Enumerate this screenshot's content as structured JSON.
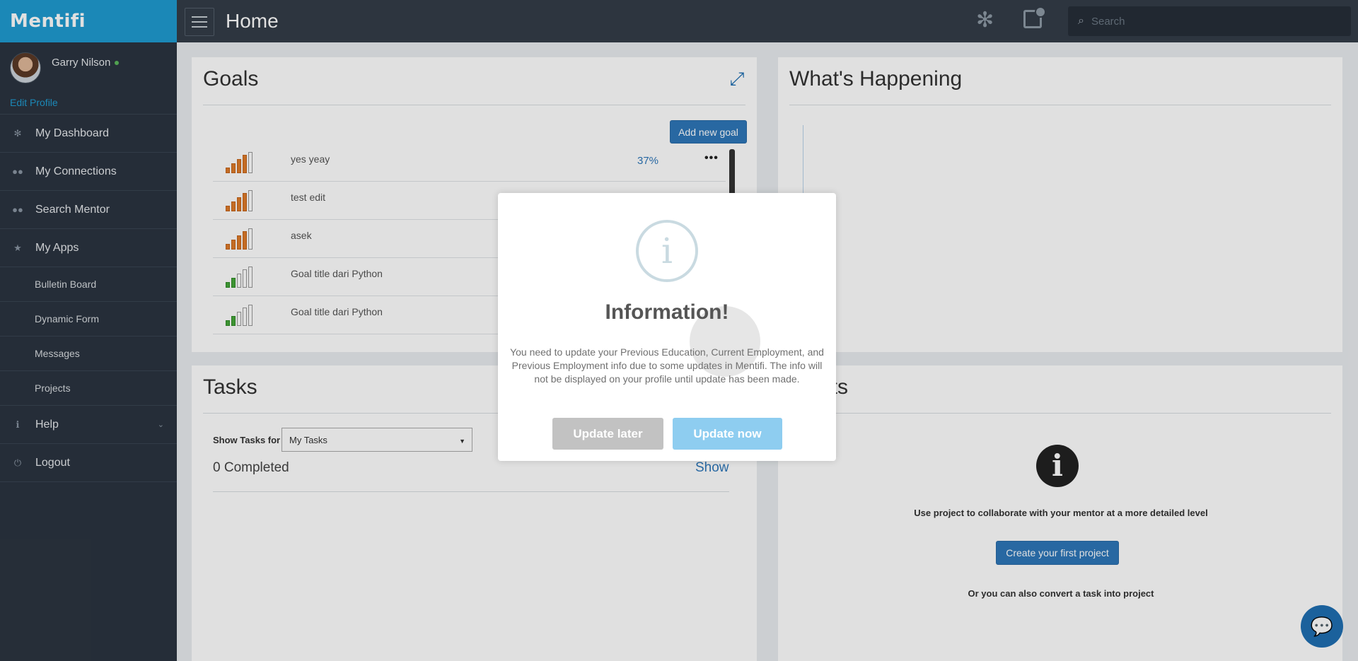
{
  "sidebar": {
    "brand": "Mentifi",
    "profile": {
      "name": "Garry Nilson",
      "edit_label": "Edit Profile"
    },
    "items": [
      {
        "label": "My Dashboard",
        "icon": "dashboard-icon"
      },
      {
        "label": "My Connections",
        "icon": "users-icon"
      },
      {
        "label": "Search Mentor",
        "icon": "users-icon"
      },
      {
        "label": "My Apps",
        "icon": "star-icon"
      }
    ],
    "apps": [
      {
        "label": "Bulletin Board"
      },
      {
        "label": "Dynamic Form"
      },
      {
        "label": "Messages"
      },
      {
        "label": "Projects"
      }
    ],
    "help": {
      "label": "Help"
    },
    "logout": {
      "label": "Logout"
    }
  },
  "header": {
    "title": "Home",
    "search_placeholder": "Search"
  },
  "goals": {
    "title": "Goals",
    "add_label": "Add new goal",
    "items": [
      {
        "title": "yes yeay",
        "percent": "37%",
        "menu": "•••",
        "level": 4,
        "color": "#e07b2a"
      },
      {
        "title": "test edit",
        "level": 4,
        "color": "#e07b2a"
      },
      {
        "title": "asek",
        "level": 4,
        "color": "#e07b2a"
      },
      {
        "title": "Goal title dari Python",
        "level": 1,
        "color": "#46a83a"
      },
      {
        "title": "Goal title dari Python",
        "level": 1,
        "color": "#46a83a"
      }
    ]
  },
  "happening": {
    "title": "What's Happening"
  },
  "tasks": {
    "title": "Tasks",
    "show_for_label": "Show Tasks for",
    "selected": "My Tasks",
    "completed": "0 Completed",
    "show_label": "Show"
  },
  "projects": {
    "title_visible": "ects",
    "description": "Use project to collaborate with your mentor at a more detailed level",
    "create_label": "Create your first project",
    "convert_text": "Or you can also convert a task into project"
  },
  "modal": {
    "title": "Information!",
    "body": "You need to update your Previous Education, Current Employment, and Previous Employment info due to some updates in Mentifi. The info will not be displayed on your profile until update has been made.",
    "later_label": "Update later",
    "now_label": "Update now"
  }
}
